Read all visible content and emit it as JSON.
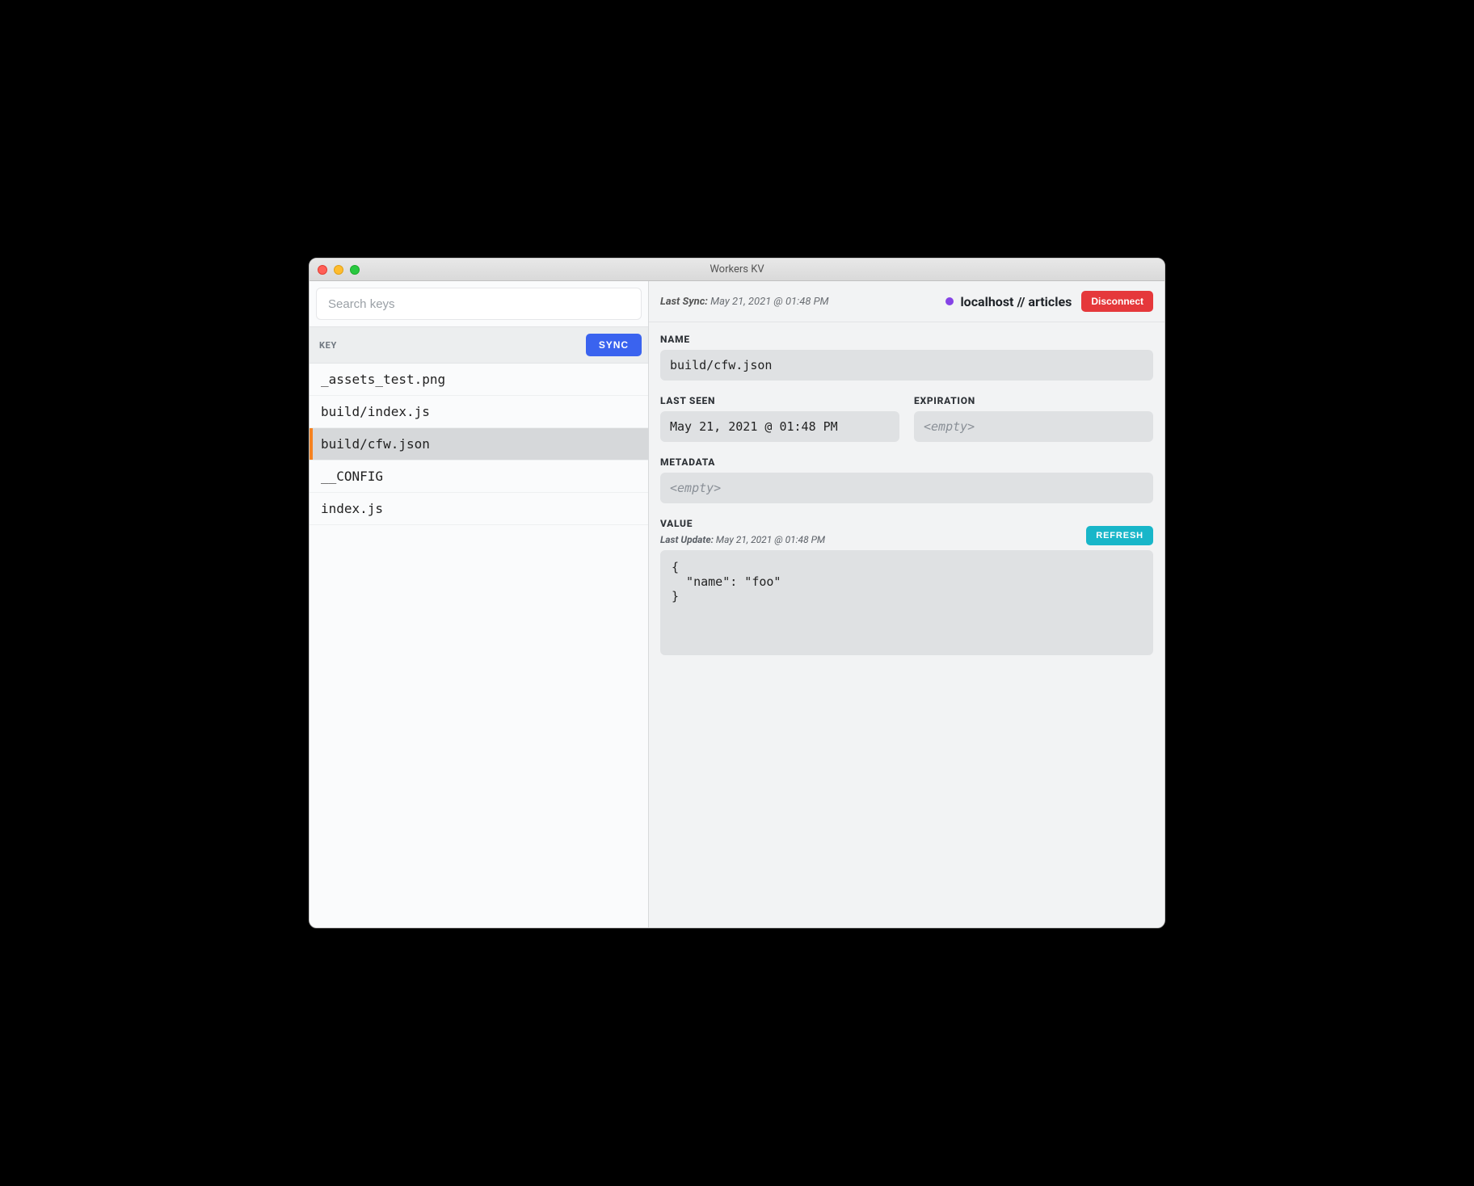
{
  "window": {
    "title": "Workers KV"
  },
  "sidebar": {
    "search_placeholder": "Search keys",
    "key_header_label": "KEY",
    "sync_button": "SYNC",
    "keys": [
      {
        "name": "_assets_test.png",
        "selected": false
      },
      {
        "name": "build/index.js",
        "selected": false
      },
      {
        "name": "build/cfw.json",
        "selected": true
      },
      {
        "name": "__CONFIG",
        "selected": false
      },
      {
        "name": "index.js",
        "selected": false
      }
    ]
  },
  "topbar": {
    "last_sync_label": "Last Sync:",
    "last_sync_value": "May 21, 2021 @ 01:48 PM",
    "connection_label": "localhost // articles",
    "status_color": "#8543e6",
    "disconnect_button": "Disconnect"
  },
  "detail": {
    "name_label": "NAME",
    "name_value": "build/cfw.json",
    "last_seen_label": "LAST SEEN",
    "last_seen_value": "May 21, 2021 @ 01:48 PM",
    "expiration_label": "EXPIRATION",
    "expiration_value": "<empty>",
    "metadata_label": "METADATA",
    "metadata_value": "<empty>",
    "value_label": "VALUE",
    "last_update_label": "Last Update:",
    "last_update_value": "May 21, 2021 @ 01:48 PM",
    "refresh_button": "REFRESH",
    "value_body": "{\n  \"name\": \"foo\"\n}"
  }
}
